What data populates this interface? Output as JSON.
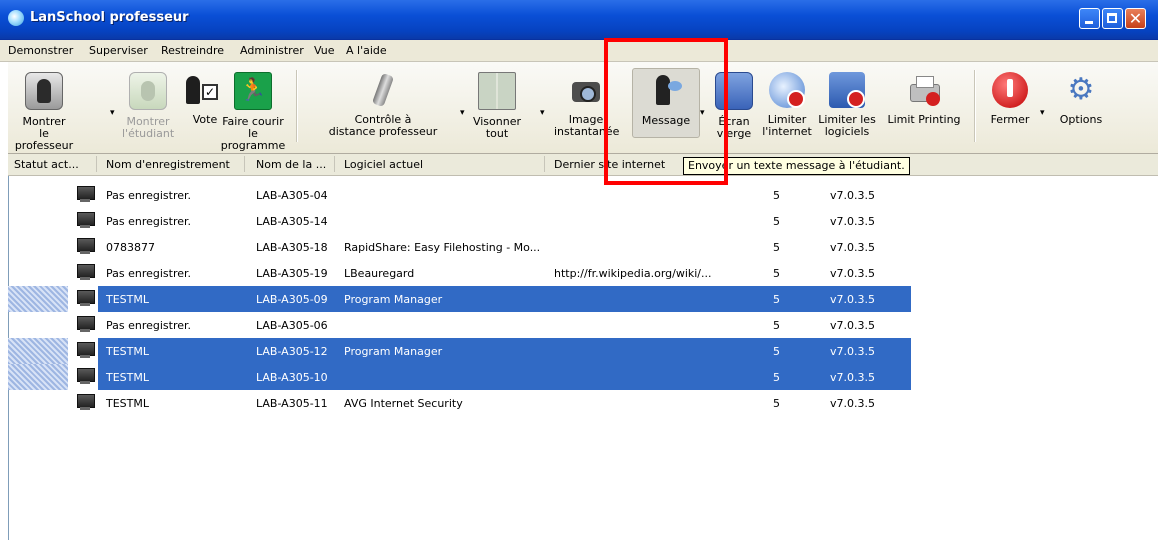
{
  "window": {
    "title": "LanSchool professeur"
  },
  "menu": [
    "Demonstrer",
    "Superviser",
    "Restreindre",
    "Administrer",
    "Vue",
    "A l'aide"
  ],
  "toolbar": {
    "montrer_prof": [
      "Montrer",
      "le professeur"
    ],
    "montrer_etud": [
      "Montrer",
      "l'étudiant"
    ],
    "vote": "Vote",
    "faire_courir": [
      "Faire courir",
      "le programme"
    ],
    "controle": [
      "Contrôle à",
      "distance professeur"
    ],
    "visonner": [
      "Visonner",
      "tout"
    ],
    "image": [
      "Image",
      "instantanée"
    ],
    "message": "Message",
    "ecran": [
      "Écran",
      "vierge"
    ],
    "limiter_internet": [
      "Limiter",
      "l'internet"
    ],
    "limiter_logiciels": [
      "Limiter les",
      "logiciels"
    ],
    "limit_printing": "Limit Printing",
    "fermer": "Fermer",
    "options": "Options"
  },
  "columns": {
    "statut": "Statut act...",
    "nom_enr": "Nom d'enregistrement",
    "nom_de_la": "Nom de la ...",
    "logiciel": "Logiciel actuel",
    "dernier": "Dernier site internet"
  },
  "tooltip": "Envoyer un texte message à l'étudiant.",
  "rows": [
    {
      "nom": "Pas enregistrer.",
      "machine": "LAB-A305-04",
      "logiciel": "",
      "site": "",
      "n": "5",
      "version": "v7.0.3.5"
    },
    {
      "nom": "Pas enregistrer.",
      "machine": "LAB-A305-14",
      "logiciel": "",
      "site": "",
      "n": "5",
      "version": "v7.0.3.5"
    },
    {
      "nom": "0783877",
      "machine": "LAB-A305-18",
      "logiciel": "RapidShare: Easy Filehosting - Mo...",
      "site": "",
      "n": "5",
      "version": "v7.0.3.5"
    },
    {
      "nom": "Pas enregistrer.",
      "machine": "LAB-A305-19",
      "logiciel": "LBeauregard",
      "site": "http://fr.wikipedia.org/wiki/...",
      "n": "5",
      "version": "v7.0.3.5"
    },
    {
      "nom": "TESTML",
      "machine": "LAB-A305-09",
      "logiciel": "Program Manager",
      "site": "",
      "n": "5",
      "version": "v7.0.3.5"
    },
    {
      "nom": "Pas enregistrer.",
      "machine": "LAB-A305-06",
      "logiciel": "",
      "site": "",
      "n": "5",
      "version": "v7.0.3.5"
    },
    {
      "nom": "TESTML",
      "machine": "LAB-A305-12",
      "logiciel": "Program Manager",
      "site": "",
      "n": "5",
      "version": "v7.0.3.5"
    },
    {
      "nom": "TESTML",
      "machine": "LAB-A305-10",
      "logiciel": "",
      "site": "",
      "n": "5",
      "version": "v7.0.3.5"
    },
    {
      "nom": "TESTML",
      "machine": "LAB-A305-11",
      "logiciel": "AVG Internet Security",
      "site": "",
      "n": "5",
      "version": "v7.0.3.5"
    }
  ],
  "colors": {
    "selection": "#316ac5",
    "titlebar": "#0a4fd6",
    "highlight_box": "#ff0000"
  }
}
